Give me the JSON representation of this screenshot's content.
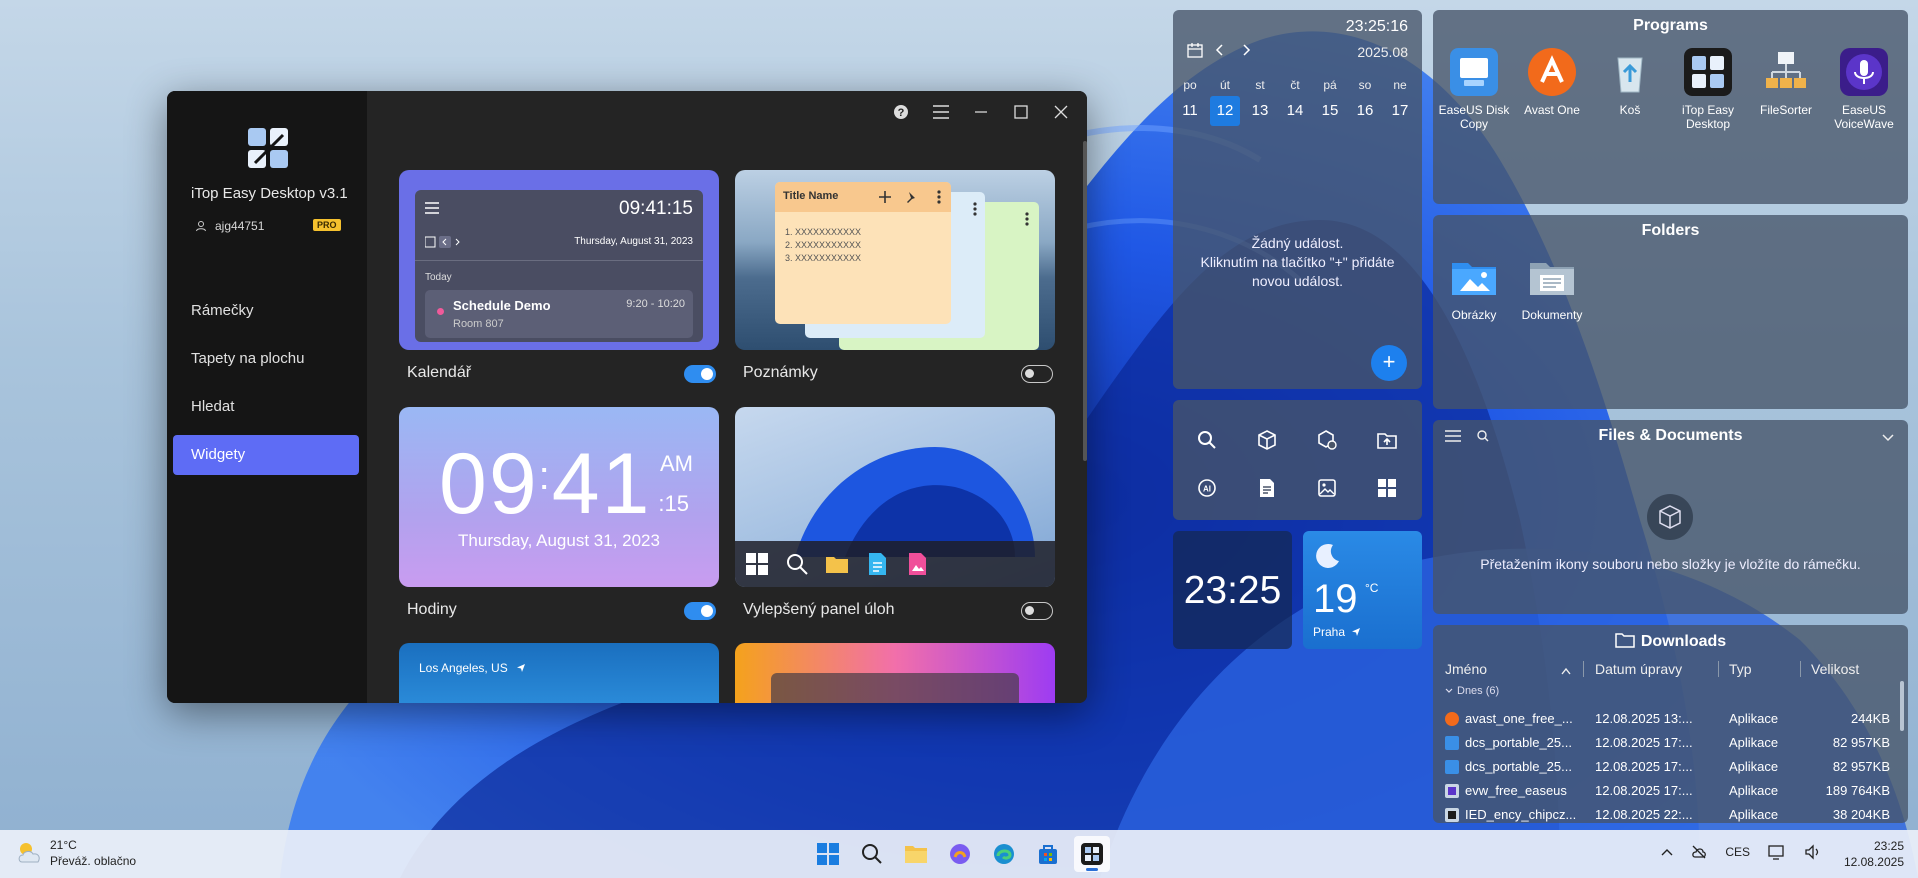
{
  "app": {
    "title": "iTop Easy Desktop v3.1",
    "user": "ajg44751",
    "badge": "PRO",
    "nav": [
      "Rámečky",
      "Tapety na plochu",
      "Hledat",
      "Widgety"
    ],
    "active_nav": "Widgety",
    "accent": "#5e6cf5"
  },
  "widgets": {
    "calendar": {
      "label": "Kalendář",
      "enabled": true,
      "preview_time": "09:41:15",
      "preview_date": "Thursday, August 31, 2023",
      "today": "Today",
      "event_title": "Schedule Demo",
      "event_room": "Room 807",
      "event_time": "9:20 - 10:20"
    },
    "notes": {
      "label": "Poznámky",
      "enabled": false,
      "note_title": "Title Name",
      "lines": [
        "1. XXXXXXXXXXX",
        "2. XXXXXXXXXXX",
        "3. XXXXXXXXXXX"
      ]
    },
    "clock": {
      "label": "Hodiny",
      "enabled": true,
      "hours": "09",
      "minutes": "41",
      "ampm": "AM",
      "seconds": ":15",
      "date": "Thursday, August 31, 2023"
    },
    "taskbar": {
      "label": "Vylepšený panel úloh",
      "enabled": false
    },
    "weather": {
      "city": "Los Angeles, US"
    }
  },
  "calendar_widget": {
    "time": "23:25:16",
    "month": "2025.08",
    "weekdays": [
      "po",
      "út",
      "st",
      "čt",
      "pá",
      "so",
      "ne"
    ],
    "days": [
      "11",
      "12",
      "13",
      "14",
      "15",
      "16",
      "17"
    ],
    "selected_day": "12",
    "empty_line1": "Žádný událost.",
    "empty_line2": "Kliknutím na tlačítko \"+\" přidáte",
    "empty_line3": "novou událost.",
    "add_label": "+"
  },
  "clock_widget": {
    "time": "23:25"
  },
  "weather_widget": {
    "temp": "19",
    "unit": "°C",
    "city": "Praha"
  },
  "programs": {
    "title": "Programs",
    "items": [
      {
        "name": "EaseUS Disk Copy",
        "icon": "disk-copy-icon",
        "color": "#3a8fe6"
      },
      {
        "name": "Avast One",
        "icon": "avast-icon",
        "color": "#f26a1b"
      },
      {
        "name": "Koš",
        "icon": "recycle-bin-icon",
        "color": "#d8e6ee"
      },
      {
        "name": "iTop Easy Desktop",
        "icon": "itop-icon",
        "color": "#1b1b1b"
      },
      {
        "name": "FileSorter",
        "icon": "filesorter-icon",
        "color": "#f0b24a"
      },
      {
        "name": "EaseUS VoiceWave",
        "icon": "voicewave-icon",
        "color": "#5b35c9"
      }
    ]
  },
  "folders": {
    "title": "Folders",
    "items": [
      {
        "name": "Obrázky",
        "icon": "pictures-folder-icon"
      },
      {
        "name": "Dokumenty",
        "icon": "documents-folder-icon"
      }
    ]
  },
  "files_docs": {
    "title": "Files & Documents",
    "hint": "Přetažením ikony souboru nebo složky je vložíte do rámečku."
  },
  "downloads": {
    "title": "Downloads",
    "columns": [
      "Jméno",
      "Datum úpravy",
      "Typ",
      "Velikost"
    ],
    "group": "Dnes (6)",
    "rows": [
      {
        "name": "avast_one_free_...",
        "date": "12.08.2025 13:...",
        "type": "Aplikace",
        "size": "244KB"
      },
      {
        "name": "dcs_portable_25...",
        "date": "12.08.2025 17:...",
        "type": "Aplikace",
        "size": "82 957KB"
      },
      {
        "name": "dcs_portable_25...",
        "date": "12.08.2025 17:...",
        "type": "Aplikace",
        "size": "82 957KB"
      },
      {
        "name": "evw_free_easeus",
        "date": "12.08.2025 17:...",
        "type": "Aplikace",
        "size": "189 764KB"
      },
      {
        "name": "IED_ency_chipcz...",
        "date": "12.08.2025 22:...",
        "type": "Aplikace",
        "size": "38 204KB"
      }
    ]
  },
  "taskbar": {
    "weather_temp": "21°C",
    "weather_desc": "Převáž. oblačno",
    "lang": "CES",
    "time": "23:25",
    "date": "12.08.2025"
  }
}
